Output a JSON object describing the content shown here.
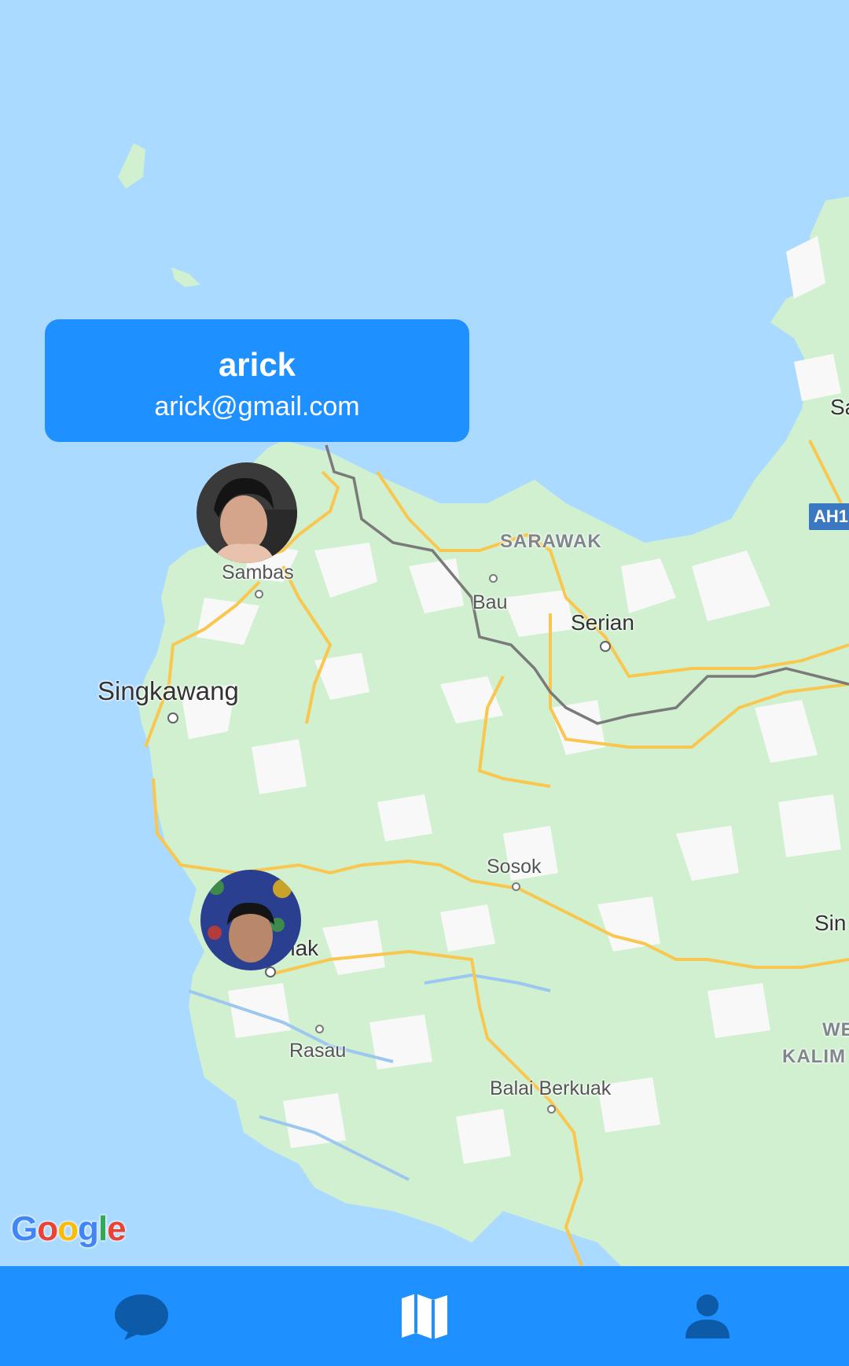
{
  "popup": {
    "name": "arick",
    "email": "arick@gmail.com"
  },
  "map": {
    "places": {
      "sambas": "Sambas",
      "singkawang": "Singkawang",
      "sarawak": "SARAWAK",
      "bau": "Bau",
      "serian": "Serian",
      "sosok": "Sosok",
      "mempawah": "hak",
      "rasau": "Rasau",
      "balai": "Balai Berkuak",
      "edge_sa": "Sa",
      "edge_sin": "Sin",
      "edge_we": "WE",
      "edge_kalim": "KALIM"
    },
    "shield": "AH1!",
    "attribution": {
      "g1": "G",
      "o1": "o",
      "o2": "o",
      "g2": "g",
      "l": "l",
      "e": "e"
    }
  },
  "markers": [
    {
      "name": "user-avatar-marker-sambas"
    },
    {
      "name": "user-avatar-marker-mempawah"
    }
  ],
  "nav": {
    "items": [
      {
        "icon": "chat-bubble-icon"
      },
      {
        "icon": "map-icon"
      },
      {
        "icon": "person-icon"
      }
    ]
  },
  "colors": {
    "accent": "#1e90ff",
    "water": "#aadaff",
    "land": "#d0f0d0",
    "road": "#f9c74f",
    "border": "#6b6b6b"
  }
}
